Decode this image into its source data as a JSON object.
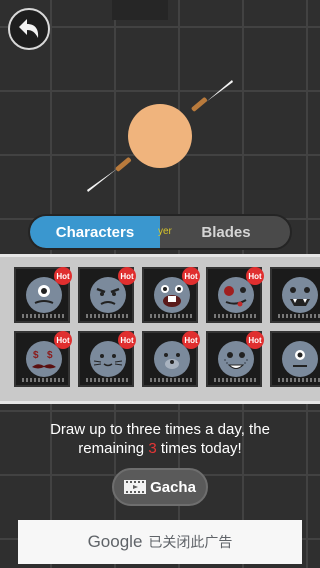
{
  "tabs": {
    "characters": "Characters",
    "blades": "Blades",
    "ghost_text": "yer"
  },
  "grid": {
    "badge": "Hot",
    "rows": [
      [
        {
          "face": "cyclops"
        },
        {
          "face": "angry"
        },
        {
          "face": "buck-teeth"
        },
        {
          "face": "zombie"
        },
        {
          "face": "monster"
        }
      ],
      [
        {
          "face": "money-mustache"
        },
        {
          "face": "cat"
        },
        {
          "face": "bear"
        },
        {
          "face": "freckles"
        },
        {
          "face": "one-eye"
        }
      ]
    ]
  },
  "info": {
    "line1": "Draw up to three times a day, the",
    "line2_pre": "remaining ",
    "count": "3",
    "line2_post": " times today!"
  },
  "gacha": {
    "label": "Gacha",
    "icon": "film-icon"
  },
  "ad": {
    "brand": "Google",
    "text": "已关闭此广告"
  },
  "colors": {
    "accent": "#3a97cf",
    "hot": "#e02f2f",
    "character_skin": "#f0b47d"
  }
}
